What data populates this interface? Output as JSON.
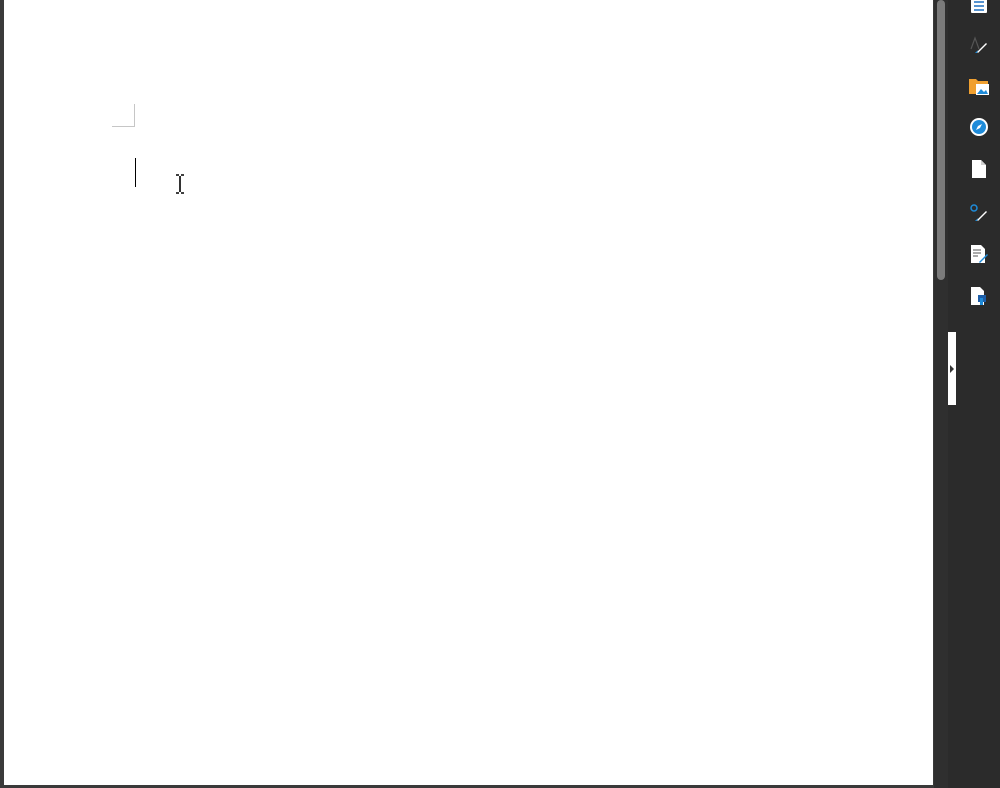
{
  "document": {
    "page_color": "#ffffff",
    "canvas_color": "#3a3a3a"
  },
  "sidebar": {
    "deck_color": "#2b2b2b",
    "tabs": [
      {
        "icon": "properties-icon"
      },
      {
        "icon": "styles-icon"
      },
      {
        "icon": "gallery-icon"
      },
      {
        "icon": "navigator-icon"
      },
      {
        "icon": "page-icon"
      },
      {
        "icon": "style-inspector-icon"
      },
      {
        "icon": "manage-changes-icon"
      },
      {
        "icon": "design-icon"
      }
    ]
  },
  "colors": {
    "accent_blue": "#1e8bd9",
    "folder_orange": "#f0a030",
    "scroll_thumb": "#7b7b7b"
  }
}
